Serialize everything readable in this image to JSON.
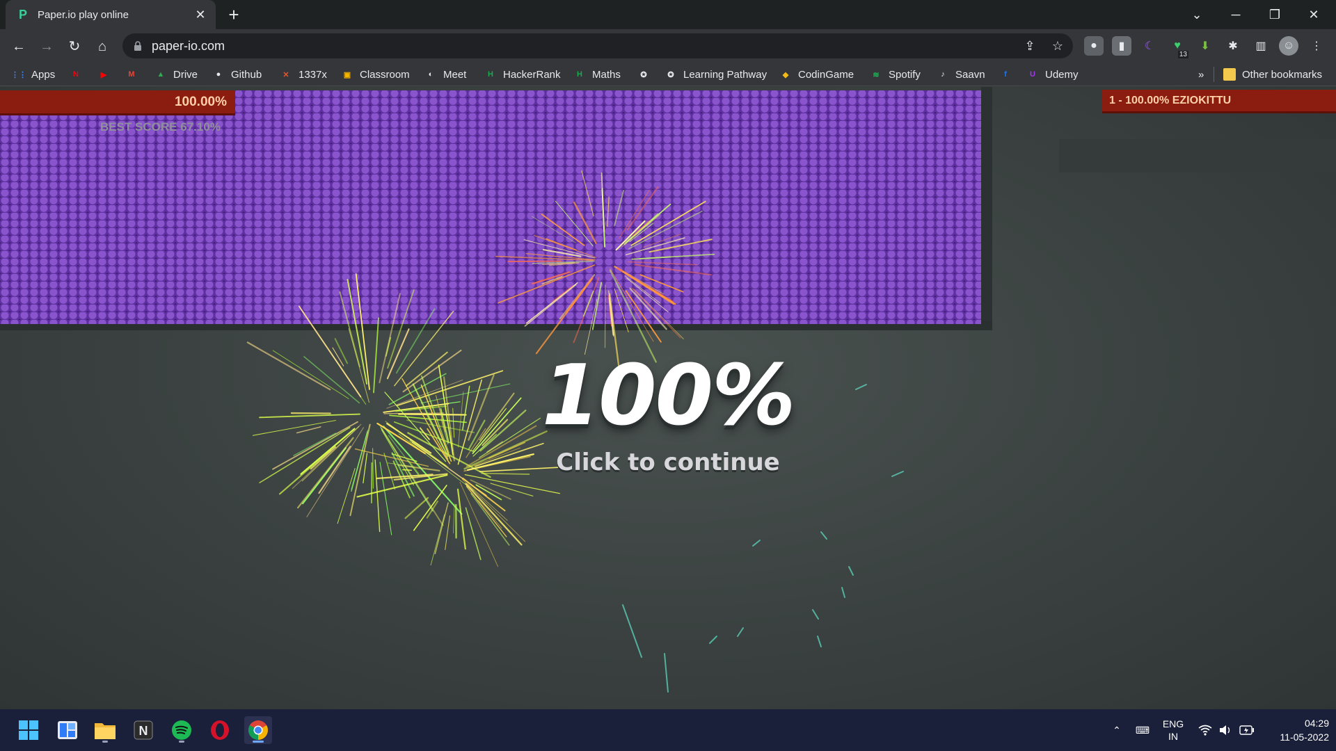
{
  "browser": {
    "tab_title": "Paper.io play online",
    "tab_favicon": "P",
    "close_tab": "✕",
    "new_tab": "+",
    "url": "paper-io.com",
    "extension_badge": "13"
  },
  "bookmarks": [
    {
      "label": "Apps",
      "icon": "apps-grid-icon",
      "color": "#4285f4"
    },
    {
      "label": "",
      "icon": "netflix-icon",
      "color": "#e50914"
    },
    {
      "label": "",
      "icon": "youtube-icon",
      "color": "#ff0000"
    },
    {
      "label": "",
      "icon": "gmail-icon",
      "color": "#ea4335"
    },
    {
      "label": "Drive",
      "icon": "drive-icon",
      "color": "#34a853"
    },
    {
      "label": "Github",
      "icon": "github-icon",
      "color": "#e8eaed"
    },
    {
      "label": "1337x",
      "icon": "x-icon",
      "color": "#e8572b"
    },
    {
      "label": "Classroom",
      "icon": "classroom-icon",
      "color": "#f4b400"
    },
    {
      "label": "Meet",
      "icon": "meet-icon",
      "color": "#e8eaed"
    },
    {
      "label": "HackerRank",
      "icon": "hackerrank-icon",
      "color": "#1ba94c"
    },
    {
      "label": "Maths",
      "icon": "hackerrank-icon",
      "color": "#1ba94c"
    },
    {
      "label": "",
      "icon": "codechef-icon",
      "color": "#e8eaed"
    },
    {
      "label": "Learning Pathway",
      "icon": "codechef-icon",
      "color": "#e8eaed"
    },
    {
      "label": "CodinGame",
      "icon": "codingame-icon",
      "color": "#f2bb13"
    },
    {
      "label": "Spotify",
      "icon": "spotify-icon",
      "color": "#1db954"
    },
    {
      "label": "Saavn",
      "icon": "saavn-icon",
      "color": "#e8eaed"
    },
    {
      "label": "",
      "icon": "facebook-icon",
      "color": "#1877f2"
    },
    {
      "label": "Udemy",
      "icon": "udemy-icon",
      "color": "#a435f0"
    }
  ],
  "bookmarks_overflow": "»",
  "other_bookmarks": "Other bookmarks",
  "game": {
    "score": "100.00%",
    "best_score": "BEST SCORE 67.10%",
    "leaderboard_entry": "1 - 100.00% EZIOKITTU",
    "big_percent": "100%",
    "continue_text": "Click to continue",
    "territory_color": "#5a2a9a",
    "score_bar_color": "#8a1d10"
  },
  "taskbar": {
    "language": "ENG",
    "region": "IN",
    "time": "04:29",
    "date": "11-05-2022"
  }
}
